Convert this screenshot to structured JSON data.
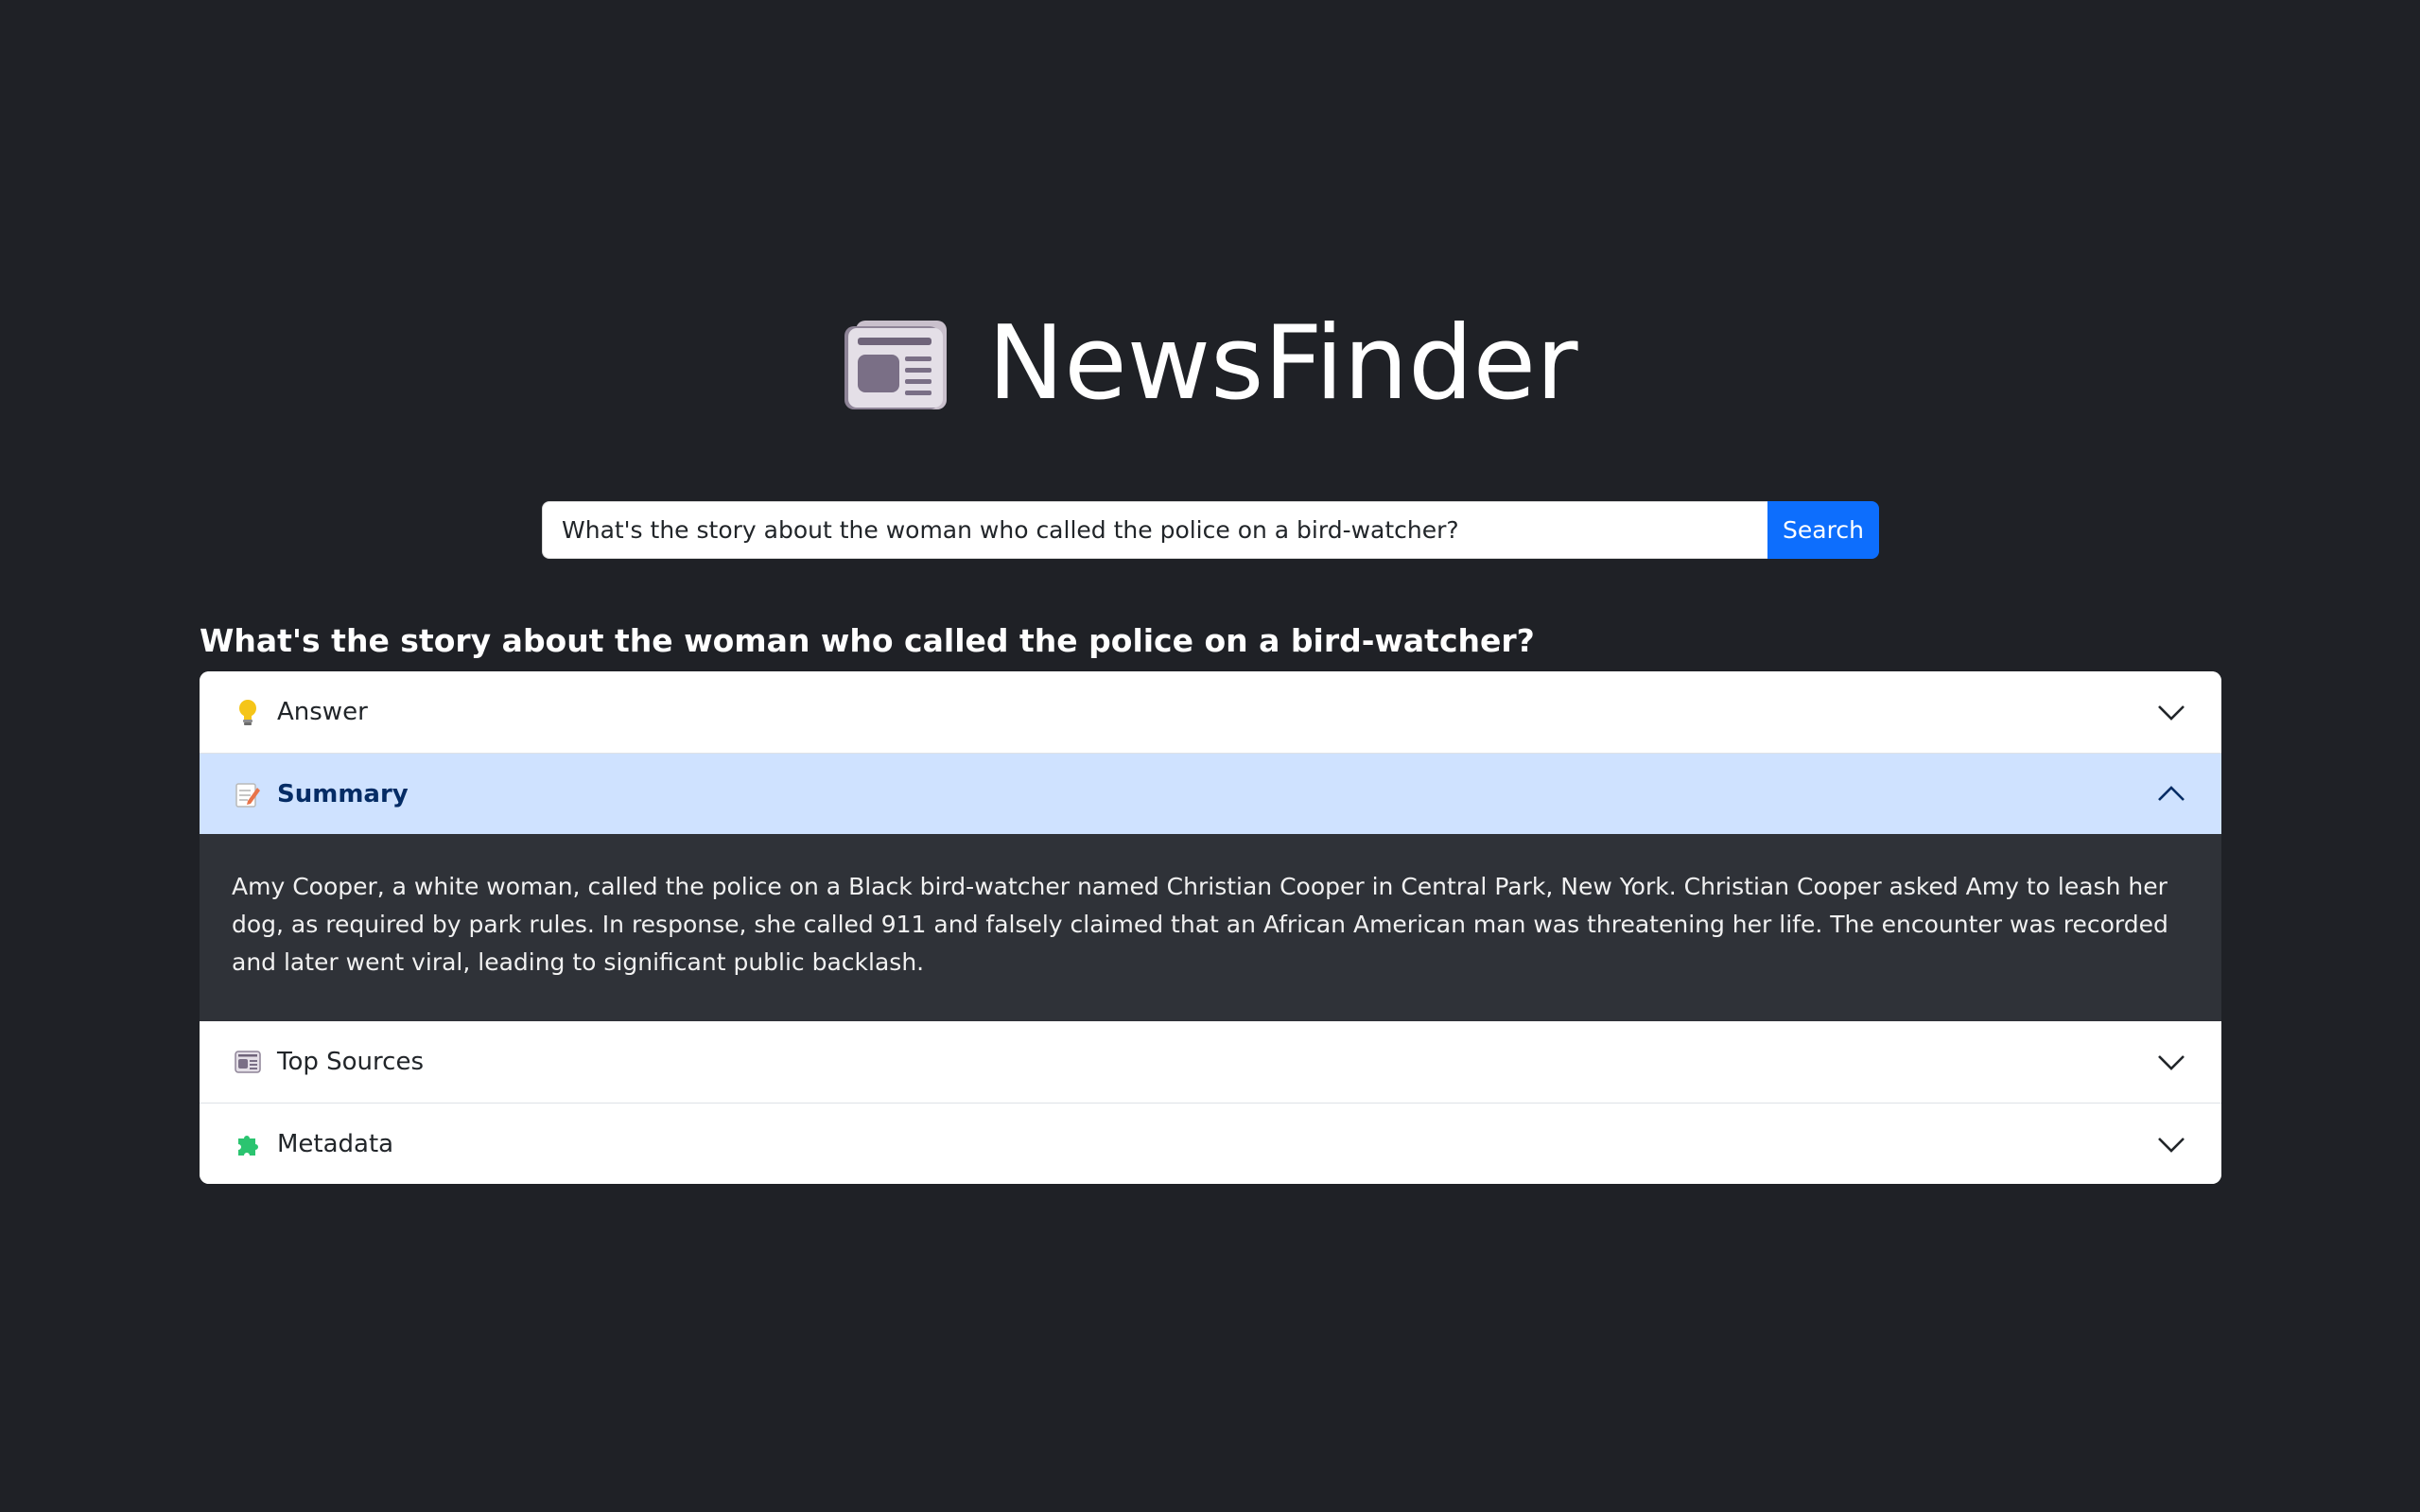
{
  "app": {
    "title": "NewsFinder",
    "logo_icon": "newspaper-icon"
  },
  "search": {
    "value": "What's the story about the woman who called the police on a bird-watcher?",
    "button_label": "Search"
  },
  "query_heading": "What's the story about the woman who called the police on a bird-watcher?",
  "accordion": {
    "items": [
      {
        "label": "Answer",
        "icon": "lightbulb-icon",
        "expanded": false
      },
      {
        "label": "Summary",
        "icon": "memo-icon",
        "expanded": true,
        "body": "Amy Cooper, a white woman, called the police on a Black bird-watcher named Christian Cooper in Central Park, New York. Christian Cooper asked Amy to leash her dog, as required by park rules. In response, she called 911 and falsely claimed that an African American man was threatening her life. The encounter was recorded and later went viral, leading to significant public backlash."
      },
      {
        "label": "Top Sources",
        "icon": "newspaper-icon",
        "expanded": false
      },
      {
        "label": "Metadata",
        "icon": "puzzle-icon",
        "expanded": false
      }
    ]
  },
  "colors": {
    "background": "#1f2126",
    "accent": "#0d6efd",
    "expanded_header": "#cfe2ff",
    "expanded_body": "#2f3238"
  }
}
